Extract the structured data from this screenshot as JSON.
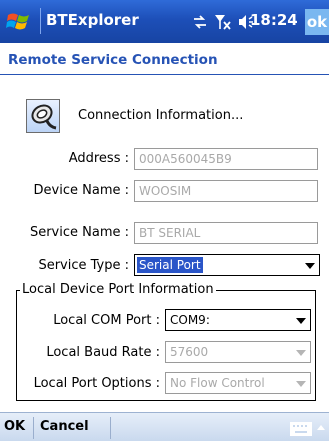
{
  "titlebar": {
    "app_title": "BTExplorer",
    "clock": "18:24",
    "ok_label": "ok",
    "icons": [
      "windows-start-icon",
      "connectivity-icon",
      "signal-off-icon",
      "volume-icon"
    ]
  },
  "dialog": {
    "title": "Remote Service Connection",
    "connection_info_label": "Connection Information..."
  },
  "fields": {
    "address": {
      "label": "Address :",
      "value": "000A560045B9"
    },
    "device_name": {
      "label": "Device Name :",
      "value": "WOOSIM"
    },
    "service_name": {
      "label": "Service Name :",
      "value": "BT SERIAL"
    },
    "service_type": {
      "label": "Service Type :",
      "value": "Serial Port"
    }
  },
  "local_port": {
    "group_title": "Local Device Port Information",
    "com_port": {
      "label": "Local COM Port :",
      "value": "COM9:"
    },
    "baud_rate": {
      "label": "Local Baud Rate :",
      "value": "57600"
    },
    "port_options": {
      "label": "Local Port Options :",
      "value": "No Flow Control"
    }
  },
  "softkeys": {
    "left": "OK",
    "right": "Cancel"
  },
  "colors": {
    "titlebar": "#1d4fb8",
    "heading": "#2653b5",
    "selection": "#2a55c8",
    "disabled_text": "#a9a9a9"
  }
}
